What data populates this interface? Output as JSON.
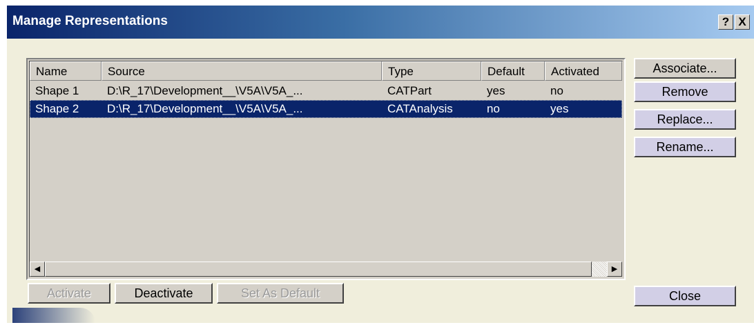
{
  "window": {
    "title": "Manage Representations",
    "help_label": "?",
    "close_label": "X"
  },
  "table": {
    "columns": [
      "Name",
      "Source",
      "Type",
      "Default",
      "Activated"
    ],
    "rows": [
      {
        "name": "Shape 1",
        "source": "D:\\R_17\\Development__\\V5A\\V5A_...",
        "type": "CATPart",
        "default": "yes",
        "activated": "no",
        "selected": false
      },
      {
        "name": "Shape 2",
        "source": "D:\\R_17\\Development__\\V5A\\V5A_...",
        "type": "CATAnalysis",
        "default": "no",
        "activated": "yes",
        "selected": true
      }
    ]
  },
  "scrollbar": {
    "left_arrow": "◀",
    "right_arrow": "▶"
  },
  "side_buttons": {
    "associate": "Associate...",
    "remove": "Remove",
    "replace": "Replace...",
    "rename": "Rename...",
    "close": "Close"
  },
  "bottom_buttons": {
    "activate": "Activate",
    "deactivate": "Deactivate",
    "set_default": "Set As Default"
  },
  "colors": {
    "selection": "#0a246a",
    "face": "#d4d0c8",
    "window_bg": "#f0eedc",
    "button_accent": "#d2cfe6"
  }
}
